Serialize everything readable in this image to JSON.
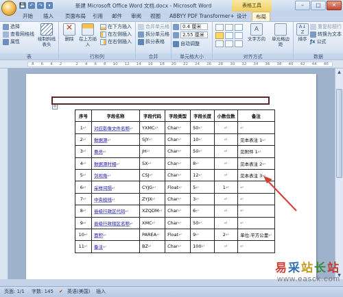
{
  "titlebar": {
    "title": "新建 Microsoft Office Word 文档.docx - Microsoft Word",
    "context_tab_header": "表格工具",
    "qat": [
      "💾",
      "↶",
      "↷",
      "▾"
    ],
    "controls": {
      "minimize": "–",
      "maximize": "□",
      "close": "✕"
    }
  },
  "tabs": [
    "开始",
    "插入",
    "页面布局",
    "引用",
    "邮件",
    "审阅",
    "视图",
    "ABBYY PDF Transformer+",
    "设计",
    "布局"
  ],
  "active_tab": "布局",
  "ribbon": {
    "table_group": {
      "select": "选择",
      "gridlines": "查看网格线",
      "properties": "属性",
      "draw_diagonal": "绘制斜线表头",
      "label": "表"
    },
    "rows_cols_group": {
      "delete": "删除",
      "insert_above": "在上方插入",
      "insert_below": "在下方插入",
      "insert_left": "在左侧插入",
      "insert_right": "在右侧插入",
      "label": "行和列"
    },
    "merge_group": {
      "merge_cells": "合并单元格",
      "split_cells": "拆分单元格",
      "split_table": "拆分表格",
      "label": "合并"
    },
    "cell_size_group": {
      "height": "0.4 厘米",
      "width": "2.55 厘米",
      "autofit": "自动调整",
      "label": "单元格大小"
    },
    "alignment_group": {
      "text_direction": "文字方向",
      "cell_margins": "单元格边距",
      "label": "对齐方式"
    },
    "data_group": {
      "sort": "排序",
      "repeat_header": "重复标题行",
      "convert": "转换为文本",
      "formula": "公式",
      "label": "数据"
    }
  },
  "ruler_ticks": [
    "8",
    "6",
    "4",
    "2",
    "",
    "2",
    "4",
    "6",
    "8",
    "10",
    "12",
    "14",
    "16",
    "18",
    "20",
    "22",
    "24",
    "26",
    "28",
    "30",
    "32",
    "34",
    "36",
    "38",
    "40",
    "42",
    "44",
    "46"
  ],
  "table": {
    "headers": [
      "序号",
      "字段名称",
      "字段代码",
      "字段类型",
      "字段长度",
      "小数位数",
      "备注"
    ],
    "rows": [
      [
        "1",
        "对应影像文件名称",
        "YXMC",
        "Char",
        "50",
        "",
        ""
      ],
      [
        "2",
        "数据源",
        "SJY",
        "Char",
        "10",
        "",
        "见本表注 1"
      ],
      [
        "3",
        "悬员",
        "JH",
        "Char",
        "50",
        "",
        "见附件 1"
      ],
      [
        "4",
        "数据源时相",
        "SX",
        "Char",
        "8",
        "",
        "见本表注 2"
      ],
      [
        "5",
        "剑视角",
        "CSJ",
        "Char",
        "12",
        "",
        "见本表注 3"
      ],
      [
        "6",
        "采样间隔",
        "CYJG",
        "Float",
        "5",
        "1",
        ""
      ],
      [
        "7",
        "中央经线",
        "ZYJX",
        "Char",
        "3",
        "",
        ""
      ],
      [
        "8",
        "县级行政区代码",
        "XZQDM",
        "Char",
        "6",
        "",
        ""
      ],
      [
        "9",
        "县级行政辖区名称",
        "XMC",
        "Char",
        "50",
        "",
        ""
      ],
      [
        "10",
        "面积",
        "PAREA",
        "Float",
        "9",
        "2",
        "单位:平方公里"
      ],
      [
        "11",
        "备注",
        "BZ",
        "Char",
        "100",
        "",
        ""
      ]
    ],
    "end_mark": "↵"
  },
  "statusbar": {
    "page": "页面: 1/1",
    "words": "字数: 145",
    "language": "英语(美国)",
    "insert": "插入"
  },
  "watermark": {
    "text": "易采站长站",
    "url": "www.easck.com"
  },
  "colors": {
    "accent_red": "#d1413a",
    "highlight_box": "#5a2626",
    "context_tab": "#f0cf62"
  }
}
